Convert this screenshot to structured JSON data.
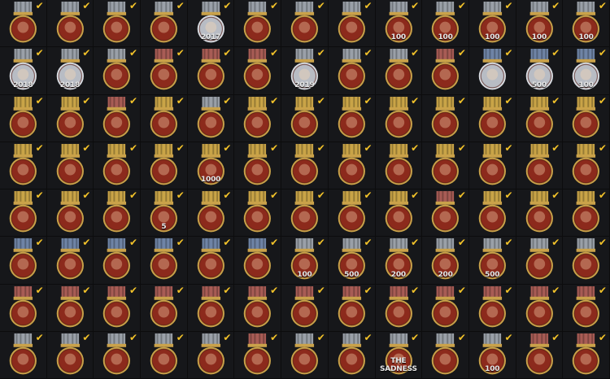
{
  "title": "",
  "colors": {
    "background": "#121315",
    "check": "#f2c22a",
    "bronze": "#8c2a1c",
    "bronze_dark": "#4a120c",
    "gold": "#caa24a",
    "silver": "#b8bcc4",
    "ribbon_gold": "#c9a447",
    "ribbon_blue": "#6f84a6",
    "ribbon_gray": "#9aa0a8",
    "ribbon_red": "#a85c55"
  },
  "rows": [
    [
      "face",
      "face",
      "face",
      "cards",
      "2017",
      "face",
      "face",
      "gold-coin",
      "100",
      "100",
      "100",
      "100",
      "100"
    ],
    [
      "2018",
      "2018",
      "face",
      "red-gem-wings",
      "blue-gem-wings",
      "gold-star-wings",
      "2019",
      "gold-coin",
      "soldier",
      "radar-wings",
      "silver-shield",
      "500",
      "silver-shield-100"
    ],
    [
      "soldier",
      "soldier-wings",
      "green-crest",
      "face",
      "cube",
      "soldier",
      "soldier",
      "wheel",
      "splat",
      "no-entry",
      "blood",
      "dollar",
      "dollar"
    ],
    [
      "hammer",
      "shield-cross",
      "flag",
      "fist",
      "1000",
      "diamond",
      "Z",
      "Z",
      "group",
      "scope",
      "hand-down",
      "eye",
      "wings"
    ],
    [
      "G",
      "helmet",
      "trophy",
      "5",
      "bomb",
      "Z",
      "target",
      "grenade",
      "Z",
      "heart-wings",
      "soldier",
      "soldier",
      "100"
    ],
    [
      "tank",
      "ZS 2",
      "ZS 3",
      "ZS 4",
      "ZS 5",
      "ZS 6",
      "100",
      "500",
      "200",
      "200",
      "500",
      "shield-green",
      "gun"
    ],
    [
      "soldier",
      "soldier",
      "eagle-crest",
      "wreath",
      "wreath",
      "soldier",
      "spider",
      "cross",
      "cannons",
      "boot",
      "bugle",
      "soldier",
      "soldier"
    ],
    [
      "soldier-wings",
      "blue-star",
      "heart",
      "purple-crest",
      "fist",
      "boss",
      "skull",
      "soldier",
      "THE SADNESS",
      "text-glyph",
      "100",
      "dragon",
      "silver-skull"
    ]
  ],
  "ribbons": [
    [
      "gray",
      "gray",
      "gray",
      "gray",
      "gray",
      "gray",
      "gray",
      "gray",
      "gray",
      "gray",
      "gray",
      "gray",
      "gray"
    ],
    [
      "gray",
      "gray",
      "gray",
      "red",
      "red",
      "red",
      "gray",
      "gray",
      "gray",
      "red",
      "blue",
      "blue",
      "blue"
    ],
    [
      "gold",
      "gold",
      "red",
      "gold",
      "gray",
      "gold",
      "gold",
      "gold",
      "gold",
      "gold",
      "gold",
      "gold",
      "gold"
    ],
    [
      "gold",
      "gold",
      "gold",
      "gold",
      "gold",
      "gold",
      "gold",
      "gold",
      "gold",
      "gold",
      "gold",
      "gold",
      "gold"
    ],
    [
      "gold",
      "gold",
      "gold",
      "gold",
      "gold",
      "gold",
      "gold",
      "gold",
      "gold",
      "red",
      "gold",
      "gold",
      "gold"
    ],
    [
      "blue",
      "blue",
      "blue",
      "blue",
      "blue",
      "blue",
      "gray",
      "gray",
      "gray",
      "gray",
      "gray",
      "gray",
      "gray"
    ],
    [
      "red",
      "red",
      "red",
      "red",
      "red",
      "red",
      "red",
      "red",
      "red",
      "red",
      "red",
      "red",
      "red"
    ],
    [
      "gray",
      "gray",
      "gray",
      "gray",
      "gray",
      "red",
      "gray",
      "gray",
      "gray",
      "gray",
      "gray",
      "red",
      "red"
    ]
  ],
  "text_labels": {
    "0-4": "2017",
    "0-8": "100",
    "0-9": "100",
    "0-10": "100",
    "0-11": "100",
    "0-12": "100",
    "1-0": "2018",
    "1-1": "2018",
    "1-6": "2019",
    "1-11": "500",
    "1-12": "100",
    "3-4": "1000",
    "4-3": "5",
    "5-6": "100",
    "5-7": "500",
    "5-8": "200",
    "5-9": "200",
    "5-10": "500",
    "7-8": "THE SADNESS",
    "7-10": "100"
  }
}
